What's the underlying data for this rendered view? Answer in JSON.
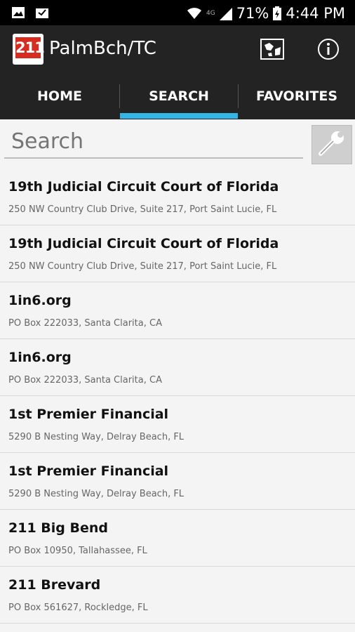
{
  "status_bar": {
    "battery": "71%",
    "time": "4:44 PM",
    "network": "4G"
  },
  "app_bar": {
    "logo_text": "211",
    "title": "PalmBch/TC"
  },
  "tabs": [
    {
      "label": "HOME"
    },
    {
      "label": "SEARCH",
      "selected": true
    },
    {
      "label": "FAVORITES"
    }
  ],
  "search": {
    "placeholder": "Search",
    "value": ""
  },
  "results": [
    {
      "name": "19th Judicial Circuit Court of Florida",
      "address": "250 NW Country Club Drive, Suite 217, Port Saint Lucie, FL"
    },
    {
      "name": "19th Judicial Circuit Court of Florida",
      "address": "250 NW Country Club Drive, Suite 217, Port Saint Lucie, FL"
    },
    {
      "name": "1in6.org",
      "address": "PO Box 222033, Santa Clarita, CA"
    },
    {
      "name": "1in6.org",
      "address": "PO Box 222033, Santa Clarita, CA"
    },
    {
      "name": "1st Premier Financial",
      "address": "5290 B Nesting Way, Delray Beach, FL"
    },
    {
      "name": "1st Premier Financial",
      "address": "5290 B Nesting Way, Delray Beach, FL"
    },
    {
      "name": "211 Big Bend",
      "address": "PO Box 10950, Tallahassee, FL"
    },
    {
      "name": "211 Brevard",
      "address": "PO Box 561627, Rockledge, FL"
    }
  ],
  "colors": {
    "tab_indicator": "#33b5e5",
    "bar_background": "#232323",
    "logo_red": "#d62d20"
  }
}
